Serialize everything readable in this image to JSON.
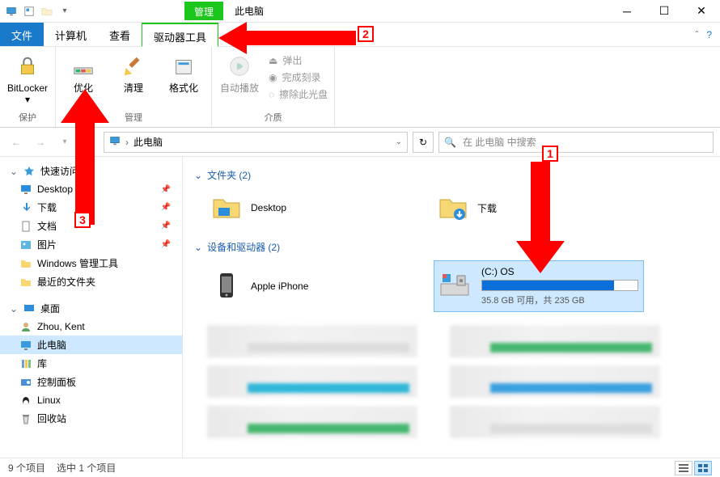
{
  "title": {
    "contextual_tab": "管理",
    "location": "此电脑"
  },
  "menu": {
    "file": "文件",
    "computer": "计算机",
    "view": "查看",
    "drive_tools": "驱动器工具"
  },
  "ribbon": {
    "protect": {
      "bitlocker": "BitLocker",
      "dropdown": "▾",
      "group": "保护"
    },
    "manage": {
      "optimize": "优化",
      "cleanup": "清理",
      "format": "格式化",
      "group": "管理"
    },
    "media": {
      "autoplay": "自动播放",
      "eject": "弹出",
      "finish_burn": "完成刻录",
      "erase_disc": "擦除此光盘",
      "group": "介质"
    }
  },
  "address": {
    "path": "此电脑",
    "chevron": "›"
  },
  "search": {
    "placeholder": "在 此电脑 中搜索"
  },
  "sidebar": {
    "quick_access": "快速访问",
    "items_qa": [
      {
        "label": "Desktop",
        "icon": "desktop"
      },
      {
        "label": "下载",
        "icon": "downloads"
      },
      {
        "label": "文档",
        "icon": "documents"
      },
      {
        "label": "图片",
        "icon": "pictures"
      },
      {
        "label": "Windows 管理工具",
        "icon": "folder"
      },
      {
        "label": "最近的文件夹",
        "icon": "folder"
      }
    ],
    "desktop_root": "桌面",
    "items_dt": [
      {
        "label": "Zhou, Kent",
        "icon": "user"
      },
      {
        "label": "此电脑",
        "icon": "pc",
        "selected": true
      },
      {
        "label": "库",
        "icon": "libraries"
      },
      {
        "label": "控制面板",
        "icon": "control"
      },
      {
        "label": "Linux",
        "icon": "linux"
      },
      {
        "label": "回收站",
        "icon": "recycle"
      }
    ]
  },
  "content": {
    "folders_hdr": "文件夹 (2)",
    "folders": [
      {
        "label": "Desktop"
      },
      {
        "label": "下载"
      }
    ],
    "devices_hdr": "设备和驱动器 (2)",
    "devices": {
      "iphone": "Apple iPhone",
      "drive_c": {
        "title": "(C:) OS",
        "free_text": "35.8 GB 可用，共 235 GB",
        "used_pct": 85
      }
    }
  },
  "status": {
    "count": "9 个项目",
    "selected": "选中 1 个项目"
  },
  "annotations": {
    "c1": "1",
    "c2": "2",
    "c3": "3"
  }
}
